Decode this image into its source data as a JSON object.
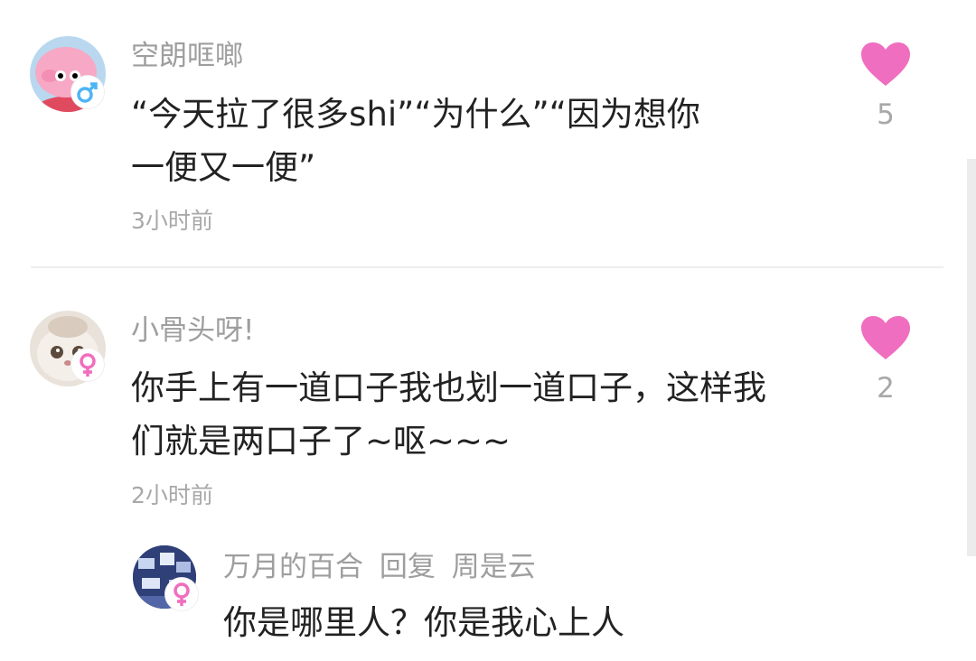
{
  "colors": {
    "like": "#f06ebf",
    "male": "#4db5f5",
    "female": "#f06ebf"
  },
  "comments": [
    {
      "username": "空朗哐啷",
      "gender": "male",
      "content_line1": "“今天拉了很多shi”“为什么”“因为想你",
      "content_line2": "一便又一便”",
      "time": "3小时前",
      "likes": "5"
    },
    {
      "username": "小骨头呀!",
      "gender": "female",
      "content_line1": "你手上有一道口子我也划一道口子，这样我",
      "content_line2": "们就是两口子了~呕~~~",
      "time": "2小时前",
      "likes": "2"
    }
  ],
  "reply": {
    "username": "万月的百合",
    "reply_label": "回复",
    "reply_to": "周是云",
    "gender": "female",
    "content": "你是哪里人？你是我心上人"
  }
}
